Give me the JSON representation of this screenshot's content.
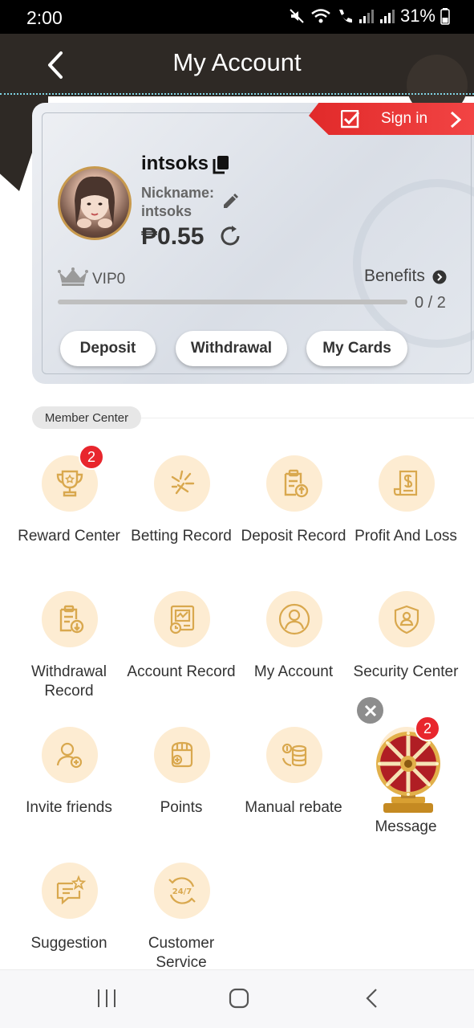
{
  "status_bar": {
    "time": "2:00",
    "battery": "31%"
  },
  "header": {
    "title": "My Account"
  },
  "sign_in": {
    "label": "Sign in"
  },
  "profile": {
    "username": "intsoks",
    "nickname_label": "Nickname:",
    "nickname_value": "intsoks",
    "balance": "₱0.55"
  },
  "vip": {
    "level": "VIP0",
    "benefits_label": "Benefits",
    "progress_text": "0 / 2",
    "progress": 0
  },
  "card_buttons": {
    "deposit": "Deposit",
    "withdrawal": "Withdrawal",
    "my_cards": "My Cards"
  },
  "member_center": {
    "title": "Member Center",
    "items": [
      {
        "label": "Reward Center",
        "icon": "trophy-icon",
        "badge": "2"
      },
      {
        "label": "Betting Record",
        "icon": "betting-record-icon"
      },
      {
        "label": "Deposit Record",
        "icon": "deposit-record-icon"
      },
      {
        "label": "Profit And Loss",
        "icon": "profit-loss-icon"
      },
      {
        "label": "Withdrawal Record",
        "icon": "withdrawal-record-icon"
      },
      {
        "label": "Account Record",
        "icon": "account-record-icon"
      },
      {
        "label": "My Account",
        "icon": "user-icon"
      },
      {
        "label": "Security Center",
        "icon": "shield-icon"
      },
      {
        "label": "Invite friends",
        "icon": "invite-icon"
      },
      {
        "label": "Points",
        "icon": "points-icon"
      },
      {
        "label": "Manual rebate",
        "icon": "rebate-icon"
      },
      {
        "label": "Message",
        "icon": "message-icon",
        "badge": "2"
      },
      {
        "label": "Suggestion",
        "icon": "suggestion-icon"
      },
      {
        "label": "Customer Service",
        "icon": "customer-service-icon"
      }
    ]
  },
  "colors": {
    "header_bg": "#2e2925",
    "accent_red": "#e8262d",
    "icon_circle": "#fdecd2",
    "icon_stroke": "#d9a84e"
  }
}
